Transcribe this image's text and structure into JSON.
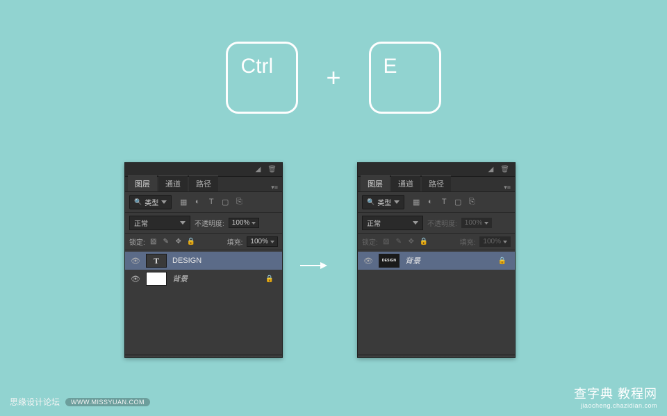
{
  "keycaps": {
    "ctrl": "Ctrl",
    "plus": "+",
    "e": "E"
  },
  "panel": {
    "tabs": {
      "layers": "图层",
      "channels": "通道",
      "paths": "路径"
    },
    "filter": {
      "type_label": "类型",
      "icons": {
        "pixel": "▦",
        "adjust": "◐",
        "type": "T",
        "shape": "▢",
        "smart": "⎘"
      }
    },
    "blend": {
      "mode": "正常",
      "opacity_label": "不透明度:",
      "opacity_value": "100%"
    },
    "lock": {
      "label": "锁定:",
      "icons": {
        "trans": "▨",
        "brush": "✎",
        "move": "✥",
        "all": "🔒"
      },
      "fill_label": "填充:",
      "fill_value": "100%"
    }
  },
  "left_layers": [
    {
      "thumb_type": "t-type",
      "thumb_text": "T",
      "name": "DESIGN",
      "sel": true,
      "italic": false,
      "locked": false
    },
    {
      "thumb_type": "t-white",
      "thumb_text": "",
      "name": "背景",
      "sel": false,
      "italic": true,
      "locked": true
    }
  ],
  "right_layers": [
    {
      "thumb_type": "t-design",
      "thumb_text": "DESIGN",
      "name": "背景",
      "sel": true,
      "italic": true,
      "locked": true
    }
  ],
  "footer": {
    "left_text": "思缘设计论坛",
    "left_url": "WWW.MISSYUAN.COM",
    "right_big": "查字典 教程网",
    "right_small": "jiaocheng.chazidian.com"
  }
}
